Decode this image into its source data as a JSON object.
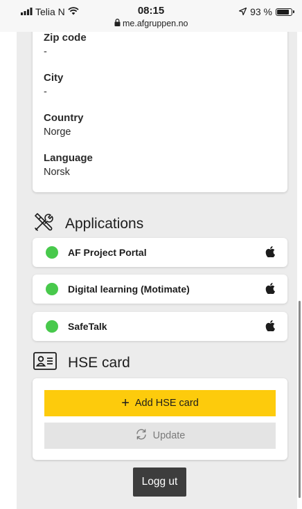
{
  "status_bar": {
    "carrier": "Telia N",
    "time": "08:15",
    "url": "me.afgruppen.no",
    "battery": "93 %",
    "battery_level_percent": 93
  },
  "address": {
    "zip_label": "Zip code",
    "zip_value": "-",
    "city_label": "City",
    "city_value": "-",
    "country_label": "Country",
    "country_value": "Norge",
    "language_label": "Language",
    "language_value": "Norsk"
  },
  "applications": {
    "title": "Applications",
    "icon": "tools-icon",
    "status_color": "#48c94c",
    "items": [
      {
        "name": "AF Project Portal",
        "platform_icon": "apple-icon"
      },
      {
        "name": "Digital learning (Motimate)",
        "platform_icon": "apple-icon"
      },
      {
        "name": "SafeTalk",
        "platform_icon": "apple-icon"
      }
    ]
  },
  "hse": {
    "title": "HSE card",
    "icon": "id-card-icon",
    "add_label": "Add HSE card",
    "update_label": "Update",
    "accent_color": "#fdcb0c"
  },
  "logout_label": "Logg ut"
}
